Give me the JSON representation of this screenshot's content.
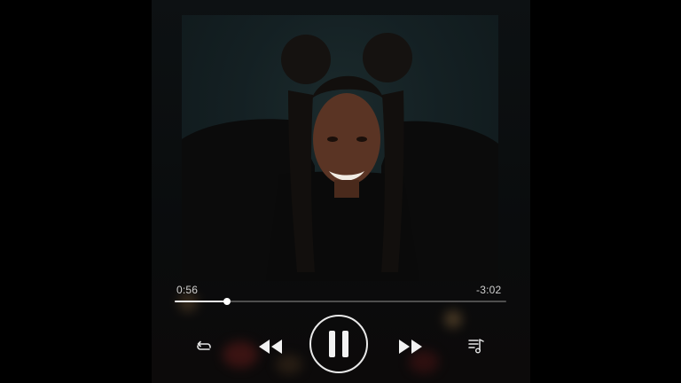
{
  "player": {
    "elapsed": "0:56",
    "remaining": "-3:02",
    "progress": 0.157
  },
  "controls": {
    "repeat": "repeat-icon",
    "rewind": "rewind-icon",
    "play_pause": "pause-icon",
    "forward": "fast-forward-icon",
    "queue": "queue-music-icon"
  },
  "colors": {
    "background": "#000000",
    "foreground": "#f2f2f2",
    "track": "#5a5a5a"
  }
}
